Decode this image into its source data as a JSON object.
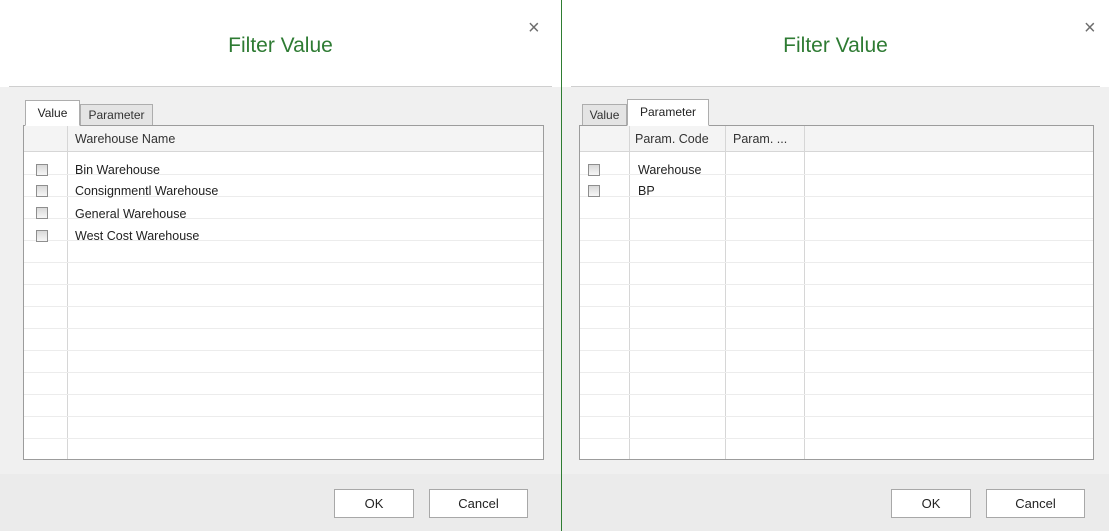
{
  "left_dialog": {
    "title": "Filter Value",
    "close_glyph": "×",
    "tabs": [
      {
        "label": "Value",
        "active": true
      },
      {
        "label": "Parameter",
        "active": false
      }
    ],
    "grid": {
      "column_header": "Warehouse Name",
      "rows": [
        {
          "name": "Bin Warehouse",
          "checked": false
        },
        {
          "name": "Consignmentl Warehouse",
          "checked": false
        },
        {
          "name": "General Warehouse",
          "checked": false
        },
        {
          "name": "West Cost Warehouse",
          "checked": false
        }
      ]
    },
    "ok_label": "OK",
    "cancel_label": "Cancel"
  },
  "right_dialog": {
    "title": "Filter Value",
    "close_glyph": "×",
    "tabs": [
      {
        "label": "Value",
        "active": false
      },
      {
        "label": "Parameter",
        "active": true
      }
    ],
    "grid": {
      "column_headers": [
        "Param. Code",
        "Param. ..."
      ],
      "rows": [
        {
          "code": "Warehouse",
          "checked": false
        },
        {
          "code": "BP",
          "checked": false
        }
      ]
    },
    "ok_label": "OK",
    "cancel_label": "Cancel"
  },
  "colors": {
    "title": "#2e7b33",
    "divider": "#2e7d32"
  }
}
